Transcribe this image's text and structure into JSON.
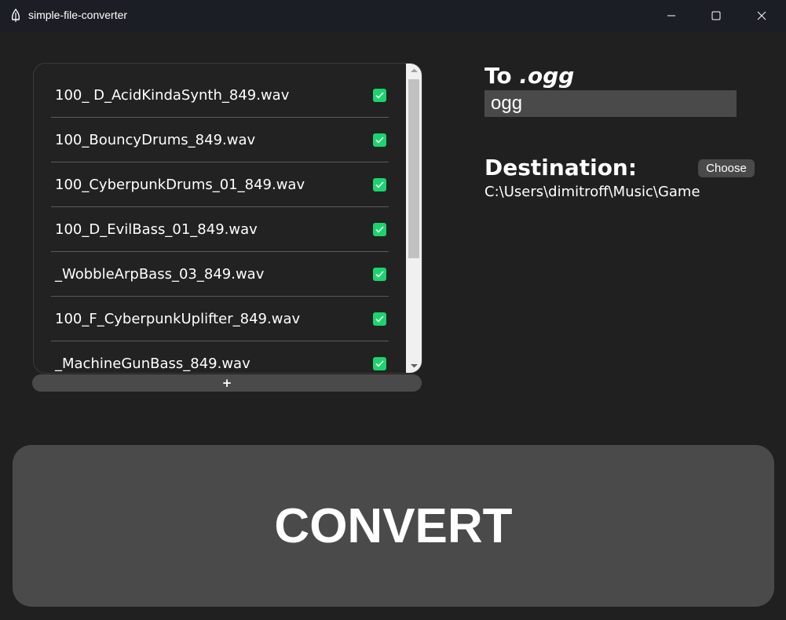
{
  "window": {
    "title": "simple-file-converter",
    "icon": "feather-icon"
  },
  "file_list": {
    "items": [
      {
        "name": "100_ D_AcidKindaSynth_849.wav",
        "checked": true
      },
      {
        "name": "100_BouncyDrums_849.wav",
        "checked": true
      },
      {
        "name": "100_CyberpunkDrums_01_849.wav",
        "checked": true
      },
      {
        "name": "100_D_EvilBass_01_849.wav",
        "checked": true
      },
      {
        "name": "_WobbleArpBass_03_849.wav",
        "checked": true
      },
      {
        "name": "100_F_CyberpunkUplifter_849.wav",
        "checked": true
      },
      {
        "name": "_MachineGunBass_849.wav",
        "checked": true
      }
    ],
    "add_label": "+"
  },
  "target": {
    "label_prefix": "To",
    "label_ext": ".ogg",
    "format_value": "ogg"
  },
  "destination": {
    "label": "Destination:",
    "choose_label": "Choose",
    "path": "C:\\Users\\dimitroff\\Music\\Game"
  },
  "convert": {
    "label": "CONVERT"
  },
  "colors": {
    "background": "#202020",
    "titlebar": "#1c1e25",
    "panel": "#4a4a4a",
    "check": "#1cd46e"
  }
}
